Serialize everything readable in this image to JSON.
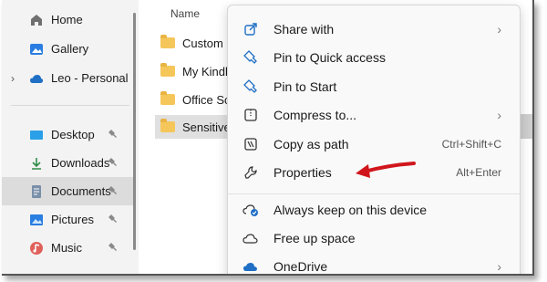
{
  "sidebar": {
    "items": [
      {
        "label": "Home",
        "icon": "home-icon"
      },
      {
        "label": "Gallery",
        "icon": "gallery-icon"
      },
      {
        "label": "Leo - Personal",
        "icon": "onedrive-cloud-icon"
      },
      {
        "label": "Desktop",
        "icon": "desktop-icon",
        "pinned": true
      },
      {
        "label": "Downloads",
        "icon": "download-icon",
        "pinned": true
      },
      {
        "label": "Documents",
        "icon": "documents-icon",
        "pinned": true,
        "selected": true
      },
      {
        "label": "Pictures",
        "icon": "pictures-icon",
        "pinned": true
      },
      {
        "label": "Music",
        "icon": "music-icon",
        "pinned": true
      }
    ]
  },
  "main": {
    "column_header": "Name",
    "files": [
      {
        "name": "Custom O"
      },
      {
        "name": "My Kindle"
      },
      {
        "name": "Office Scrip"
      },
      {
        "name": "SensitiveD",
        "selected": true
      }
    ]
  },
  "context_menu": {
    "items": [
      {
        "label": "Share with",
        "icon": "share-icon",
        "submenu": "›"
      },
      {
        "label": "Pin to Quick access",
        "icon": "pin-icon"
      },
      {
        "label": "Pin to Start",
        "icon": "pin-icon"
      },
      {
        "label": "Compress to...",
        "icon": "archive-icon",
        "submenu": "›"
      },
      {
        "label": "Copy as path",
        "icon": "copy-path-icon",
        "shortcut": "Ctrl+Shift+C"
      },
      {
        "label": "Properties",
        "icon": "wrench-icon",
        "shortcut": "Alt+Enter"
      },
      {
        "label": "Always keep on this device",
        "icon": "cloud-sync-icon"
      },
      {
        "label": "Free up space",
        "icon": "cloud-icon"
      },
      {
        "label": "OneDrive",
        "icon": "onedrive-icon",
        "submenu": "›"
      }
    ]
  },
  "colors": {
    "accent_blue": "#1f6fc5",
    "annotation_arrow": "#d0161c",
    "folder_yellow": "#f5c65a"
  }
}
